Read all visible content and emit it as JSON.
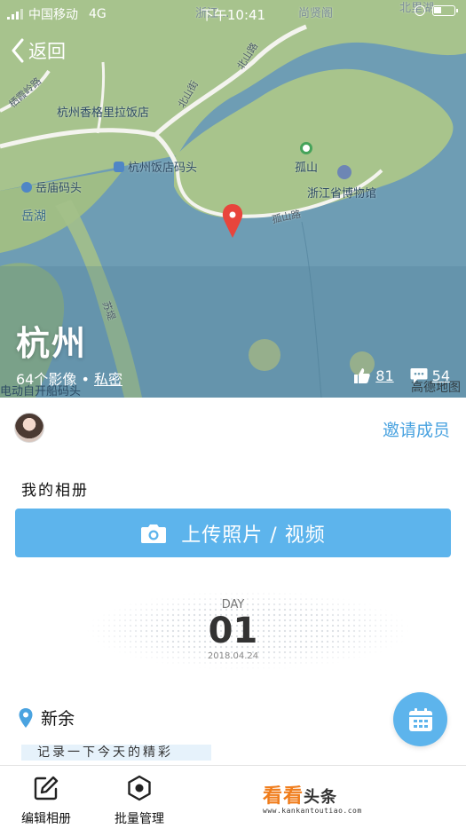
{
  "status_bar": {
    "carrier": "中国移动",
    "network": "4G",
    "time": "下午10:41"
  },
  "map": {
    "labels": {
      "top_overlay": "浙江...",
      "shangxian": "尚贤阁",
      "beishan_top": "北里湖",
      "xixialing": "栖霞岭路",
      "shangrila": "杭州香格里拉饭店",
      "beishan_st": "北山街",
      "beishan_rd": "北山路",
      "hotel_dock": "杭州饭店码头",
      "gushan": "孤山",
      "yuemiao": "岳庙码头",
      "museum": "浙江省博物馆",
      "yuehu": "岳湖",
      "gushan_rd": "孤山路",
      "sudi": "苏堤",
      "electric_boat": "电动自开船码头"
    },
    "brand": "高德地图",
    "colors": {
      "water": "#6f9fb6",
      "land": "#a9c58f",
      "road": "#f3f3ee",
      "pin": "#e8453c"
    }
  },
  "nav": {
    "back_label": "返回",
    "back_icon": "chevron-left-icon"
  },
  "album": {
    "title": "杭州",
    "photo_count": "64个影像",
    "separator": "•",
    "privacy": "私密",
    "likes": "81",
    "comments": "54"
  },
  "members": {
    "invite_label": "邀请成员"
  },
  "album_name": "我的相册",
  "upload": {
    "label": "上传照片 / 视频",
    "icon": "camera-icon"
  },
  "day": {
    "label": "DAY",
    "number": "01",
    "date": "2018.04.24"
  },
  "location": {
    "name": "新余",
    "icon": "location-pin-icon"
  },
  "note": "记录一下今天的精彩",
  "calendar_button": {
    "icon": "calendar-icon"
  },
  "toolbar": {
    "edit_label": "编辑相册",
    "batch_label": "批量管理"
  },
  "watermark": {
    "main": "看看",
    "main_suffix": "头条",
    "url": "www.kankantoutiao.com"
  },
  "accent_color": "#5db4ec"
}
